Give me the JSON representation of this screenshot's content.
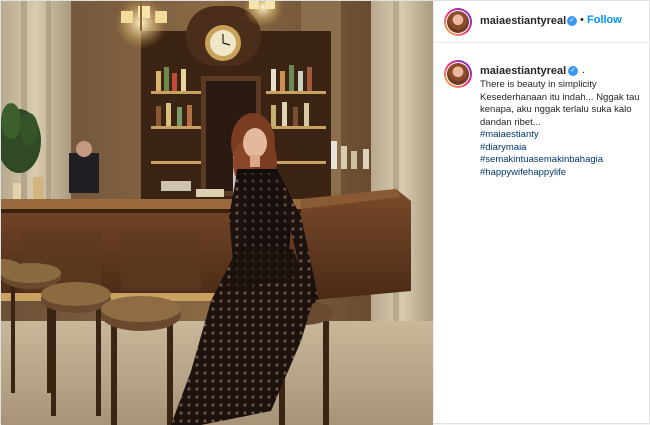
{
  "post": {
    "username": "maiaestiantyreal",
    "follow_separator": "•",
    "follow_label": "Follow",
    "verified_glyph": "✓",
    "caption_suffix": ".",
    "caption_lines": [
      "There is beauty in simplicity",
      "Kesederhanaan itu indah... Nggak tau",
      "kenapa, aku nggak terlalu suka kalo",
      "dandan ribet..."
    ],
    "hashtags": [
      "#maiaestianty",
      "#diarymaia",
      "#semakintuasemakinbahagia",
      "#happywifehappylife"
    ]
  },
  "colors": {
    "link": "#00376b",
    "follow": "#0095f6",
    "verified": "#3897f0"
  },
  "icons": {
    "verified": "verified-badge-icon",
    "avatar": "profile-avatar"
  }
}
